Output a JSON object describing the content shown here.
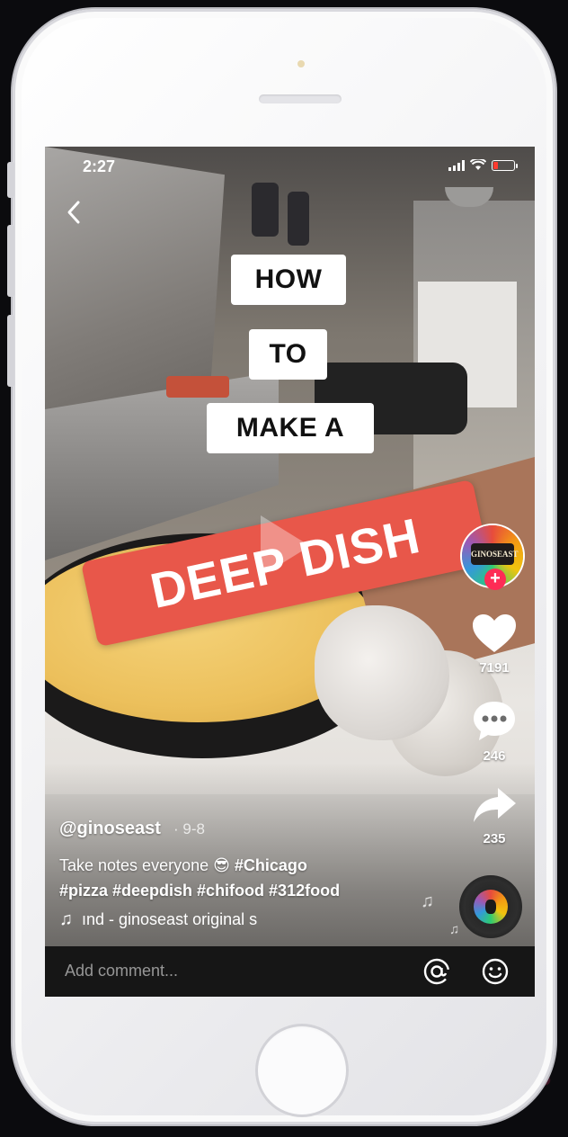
{
  "status": {
    "time": "2:27"
  },
  "overlay": {
    "line1": "HOW",
    "line2": "TO",
    "line3": "MAKE A",
    "banner": "DEEP DISH"
  },
  "creator": {
    "avatar_text": "GINOSEAST"
  },
  "actions": {
    "likes": "7191",
    "comments": "246",
    "shares": "235"
  },
  "post": {
    "username": "@ginoseast",
    "date": "· 9-8",
    "description_text": "Take notes everyone",
    "emoji": "😎",
    "tags_line1": "#Chicago",
    "tags_line2": "#pizza #deepdish #chifood #312food",
    "music": "ınd - ginoseast    original s"
  },
  "comment": {
    "placeholder": "Add comment..."
  },
  "colors": {
    "accent": "#fe2c55",
    "banner": "#e8574a"
  },
  "icons": [
    "back-icon",
    "heart-icon",
    "comment-icon",
    "share-icon",
    "music-note-icon",
    "at-icon",
    "emoji-icon",
    "play-icon",
    "plus-icon"
  ]
}
